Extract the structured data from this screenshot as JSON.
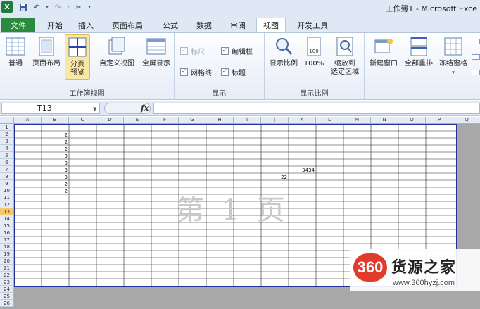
{
  "window": {
    "title": "工作簿1 - Microsoft Exce"
  },
  "tabs": [
    {
      "label": "文件",
      "key": "file"
    },
    {
      "label": "开始",
      "key": "home"
    },
    {
      "label": "插入",
      "key": "insert"
    },
    {
      "label": "页面布局",
      "key": "layout"
    },
    {
      "label": "公式",
      "key": "formulas"
    },
    {
      "label": "数据",
      "key": "data"
    },
    {
      "label": "审阅",
      "key": "review"
    },
    {
      "label": "视图",
      "key": "view"
    },
    {
      "label": "开发工具",
      "key": "developer"
    }
  ],
  "ribbon": {
    "workbook_views": {
      "label": "工作簿视图",
      "normal": "普通",
      "page_layout": "页面布局",
      "page_break_line1": "分页",
      "page_break_line2": "预览",
      "custom_views": "自定义视图",
      "full_screen": "全屏显示"
    },
    "show": {
      "label": "显示",
      "ruler": "标尺",
      "formula_bar": "编辑栏",
      "gridlines": "网格线",
      "headings": "标题"
    },
    "zoom": {
      "label": "显示比例",
      "zoom": "显示比例",
      "hundred": "100%",
      "zoom_sel_line1": "缩放到",
      "zoom_sel_line2": "选定区域"
    },
    "window": {
      "new_window": "新建窗口",
      "arrange_all": "全部重排",
      "freeze_panes": "冻结窗格"
    }
  },
  "formula_bar": {
    "name_box": "T13",
    "fx": "fx",
    "value": ""
  },
  "grid": {
    "columns": [
      "A",
      "B",
      "C",
      "D",
      "E",
      "F",
      "G",
      "H",
      "I",
      "J",
      "K",
      "L",
      "M",
      "N",
      "O",
      "P",
      "Q"
    ],
    "rows": [
      "1",
      "2",
      "3",
      "4",
      "5",
      "6",
      "7",
      "8",
      "9",
      "10",
      "11",
      "12",
      "13",
      "14",
      "15",
      "16",
      "17",
      "18",
      "19",
      "20",
      "21",
      "22",
      "23",
      "24",
      "25",
      "26"
    ],
    "selected_row": "13",
    "cells": [
      {
        "col": "B",
        "row": "2",
        "value": "2"
      },
      {
        "col": "B",
        "row": "3",
        "value": "2"
      },
      {
        "col": "B",
        "row": "4",
        "value": "2"
      },
      {
        "col": "B",
        "row": "5",
        "value": "3"
      },
      {
        "col": "B",
        "row": "6",
        "value": "3"
      },
      {
        "col": "B",
        "row": "7",
        "value": "3"
      },
      {
        "col": "B",
        "row": "8",
        "value": "3"
      },
      {
        "col": "B",
        "row": "9",
        "value": "2"
      },
      {
        "col": "B",
        "row": "10",
        "value": "2"
      },
      {
        "col": "K",
        "row": "7",
        "value": "3434"
      },
      {
        "col": "J",
        "row": "8",
        "value": "22"
      }
    ],
    "page_watermark": "第 1 页"
  },
  "brand": {
    "badge": "360",
    "name": "货源之家",
    "url": "www.360hyzj.com"
  }
}
